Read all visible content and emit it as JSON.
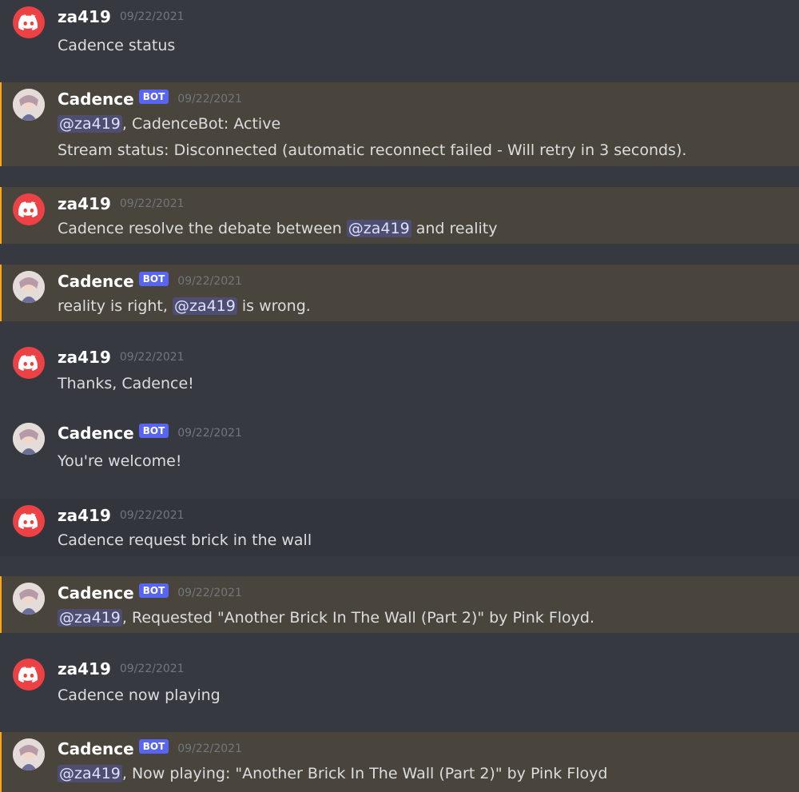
{
  "messages": [
    {
      "author": "za419",
      "timestamp": "09/22/2021",
      "text": "Cadence status"
    },
    {
      "author": "Cadence",
      "badge": "BOT",
      "timestamp": "09/22/2021",
      "mention": "@za419",
      "text": ", CadenceBot: Active",
      "line2": "Stream status: Disconnected (automatic reconnect failed - Will retry in 3 seconds)."
    },
    {
      "author": "za419",
      "timestamp": "09/22/2021",
      "text": "Cadence resolve the debate between ",
      "mention": "@za419",
      "text_after": " and reality"
    },
    {
      "author": "Cadence",
      "badge": "BOT",
      "timestamp": "09/22/2021",
      "text": "reality is right, ",
      "mention": "@za419",
      "text_after": " is wrong."
    },
    {
      "author": "za419",
      "timestamp": "09/22/2021",
      "text": "Thanks, Cadence!"
    },
    {
      "author": "Cadence",
      "badge": "BOT",
      "timestamp": "09/22/2021",
      "text": "You're welcome!"
    },
    {
      "author": "za419",
      "timestamp": "09/22/2021",
      "text": "Cadence request brick in the wall"
    },
    {
      "author": "Cadence",
      "badge": "BOT",
      "timestamp": "09/22/2021",
      "mention": "@za419",
      "text": ", Requested \"Another Brick In The Wall (Part 2)\" by Pink Floyd."
    },
    {
      "author": "za419",
      "timestamp": "09/22/2021",
      "text": "Cadence now playing"
    },
    {
      "author": "Cadence",
      "badge": "BOT",
      "timestamp": "09/22/2021",
      "mention": "@za419",
      "text": ", Now playing: \"Another Brick In The Wall (Part 2)\" by Pink Floyd"
    }
  ],
  "colors": {
    "background": "#36393f",
    "highlight": "#49443c",
    "highlight_bar": "#faa61a",
    "hover": "#32353b",
    "discord_avatar": "#ed4245",
    "bot_badge": "#5865f2",
    "mention_text": "#dee0fc"
  },
  "icons": {
    "user_avatar": "discord-logo-icon",
    "bot_avatar": "anime-avatar-icon"
  }
}
